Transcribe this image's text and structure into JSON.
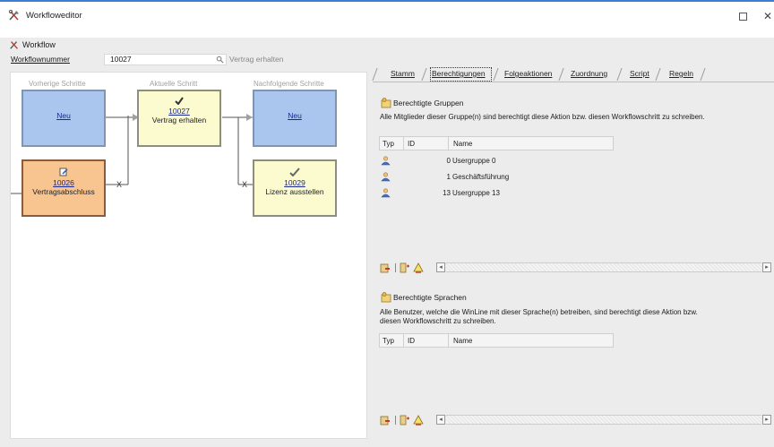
{
  "window": {
    "title": "Workfloweditor",
    "maximize_icon": "maximize-icon",
    "close_icon": "close-icon",
    "close_glyph": "✕"
  },
  "workflow_header": {
    "label": "Workflow",
    "icon": "tools-icon"
  },
  "form": {
    "number_label": "Workflownummer",
    "number_value": "10027",
    "description": "Vertrag erhalten",
    "search_icon": "search-icon"
  },
  "designer": {
    "columns": [
      "Vorherige Schritte",
      "Aktuelle Schritt",
      "Nachfolgende Schritte"
    ],
    "nodes": {
      "prev_new": {
        "link": "Neu"
      },
      "current": {
        "link": "10027",
        "text": "Vertrag erhalten",
        "icon": "checkmark-icon"
      },
      "next_new": {
        "link": "Neu"
      },
      "prev_step": {
        "link": "10026",
        "text": "Vertragsabschluss",
        "icon": "edit-icon"
      },
      "next_step": {
        "link": "10029",
        "text": "Lizenz ausstellen",
        "icon": "pencil-check-icon"
      }
    },
    "connector_x": "X"
  },
  "tabs": [
    "Stamm",
    "Berechtigungen",
    "Folgeaktionen",
    "Zuordnung",
    "Script",
    "Regeln"
  ],
  "active_tab": "Berechtigungen",
  "groups": {
    "title": "Berechtigte Gruppen",
    "description": "Alle Mitglieder dieser Gruppe(n) sind berechtigt diese Aktion bzw. diesen Workflowschritt zu schreiben.",
    "columns": [
      "Typ",
      "ID",
      "Name"
    ],
    "rows": [
      {
        "id": "0",
        "name": "Usergruppe 0"
      },
      {
        "id": "1",
        "name": "Geschäftsführung"
      },
      {
        "id": "13",
        "name": "Usergruppe 13"
      }
    ]
  },
  "languages": {
    "title": "Berechtigte Sprachen",
    "description": "Alle Benutzer, welche die WinLine mit dieser Sprache(n) betreiben, sind berechtigt diese Aktion bzw. diesen Workflowschritt zu schreiben.",
    "columns": [
      "Typ",
      "ID",
      "Name"
    ],
    "rows": []
  },
  "scroll": {
    "left": "◂",
    "right": "▸"
  },
  "colors": {
    "accent": "#3b7fd4",
    "node_blue": "#aac6ee",
    "node_yellow": "#fcfbcf",
    "node_orange": "#f8c48f",
    "link": "#1a2a8a"
  }
}
